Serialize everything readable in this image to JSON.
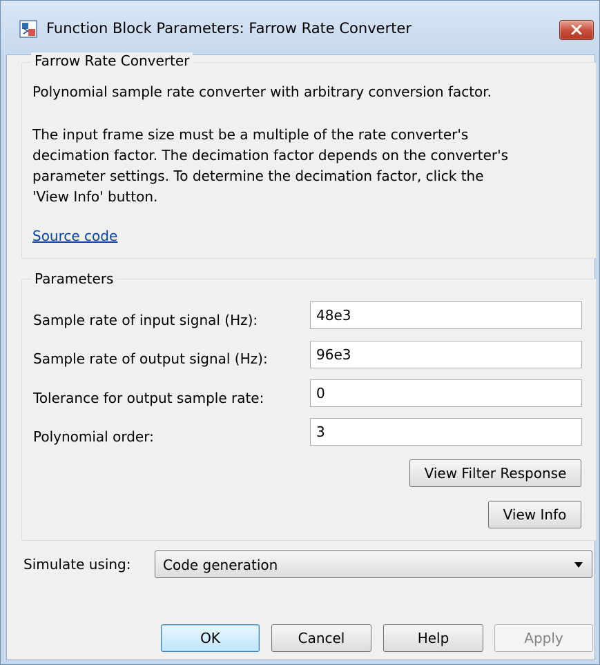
{
  "window": {
    "title": "Function Block Parameters: Farrow Rate Converter"
  },
  "description_group": {
    "title": "Farrow Rate Converter",
    "line1": "Polynomial sample rate converter with arbitrary conversion factor.",
    "para2_lines": [
      "The input frame size must be a multiple of the rate converter's",
      "decimation factor. The decimation factor depends on the converter's",
      "parameter settings. To determine the decimation factor, click the",
      "'View Info' button."
    ],
    "link": "Source code"
  },
  "parameters_group": {
    "title": "Parameters",
    "fields": [
      {
        "label": "Sample rate of input signal (Hz):",
        "value": "48e3"
      },
      {
        "label": "Sample rate of output signal (Hz):",
        "value": "96e3"
      },
      {
        "label": "Tolerance for output sample rate:",
        "value": "0"
      },
      {
        "label": "Polynomial order:",
        "value": "3"
      }
    ],
    "view_filter_response": "View Filter Response",
    "view_info": "View Info"
  },
  "simulate": {
    "label": "Simulate using:",
    "value": "Code generation"
  },
  "footer": {
    "ok": "OK",
    "cancel": "Cancel",
    "help": "Help",
    "apply": "Apply"
  },
  "icons": {
    "window": "simulink-block-icon",
    "close": "close-icon",
    "dropdown": "chevron-down-icon"
  },
  "colors": {
    "titlebar": "#c7d9ee",
    "close": "#c9513e",
    "link": "#0645ad",
    "default_button": "#bee6fd"
  }
}
